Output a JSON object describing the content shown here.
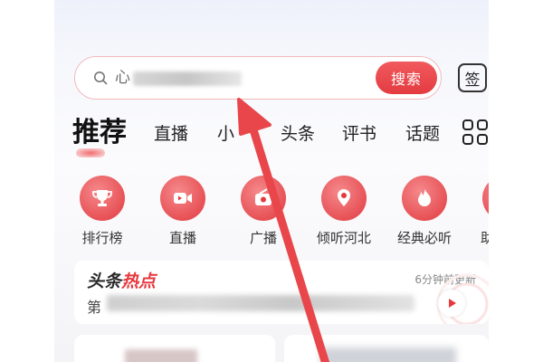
{
  "search": {
    "prefix_text": "心",
    "button_label": "搜索"
  },
  "header": {
    "signin_label": "签"
  },
  "tabs": [
    {
      "label": "推荐",
      "active": true
    },
    {
      "label": "直播"
    },
    {
      "label": "小"
    },
    {
      "label": "头条"
    },
    {
      "label": "评书"
    },
    {
      "label": "话题"
    }
  ],
  "shortcuts": [
    {
      "label": "排行榜",
      "icon": "trophy-icon"
    },
    {
      "label": "直播",
      "icon": "video-camera-icon"
    },
    {
      "label": "广播",
      "icon": "radio-icon"
    },
    {
      "label": "倾听河北",
      "icon": "location-pin-icon"
    },
    {
      "label": "经典必听",
      "icon": "flame-icon"
    },
    {
      "label": "助",
      "icon": "assistant-icon"
    }
  ],
  "headline": {
    "title_part1": "头条",
    "title_part2": "热点",
    "updated": "6分钟前更新",
    "first_char": "第"
  },
  "colors": {
    "accent": "#e6383e",
    "tab_text": "#222222",
    "annotation_arrow": "#e8464a"
  }
}
